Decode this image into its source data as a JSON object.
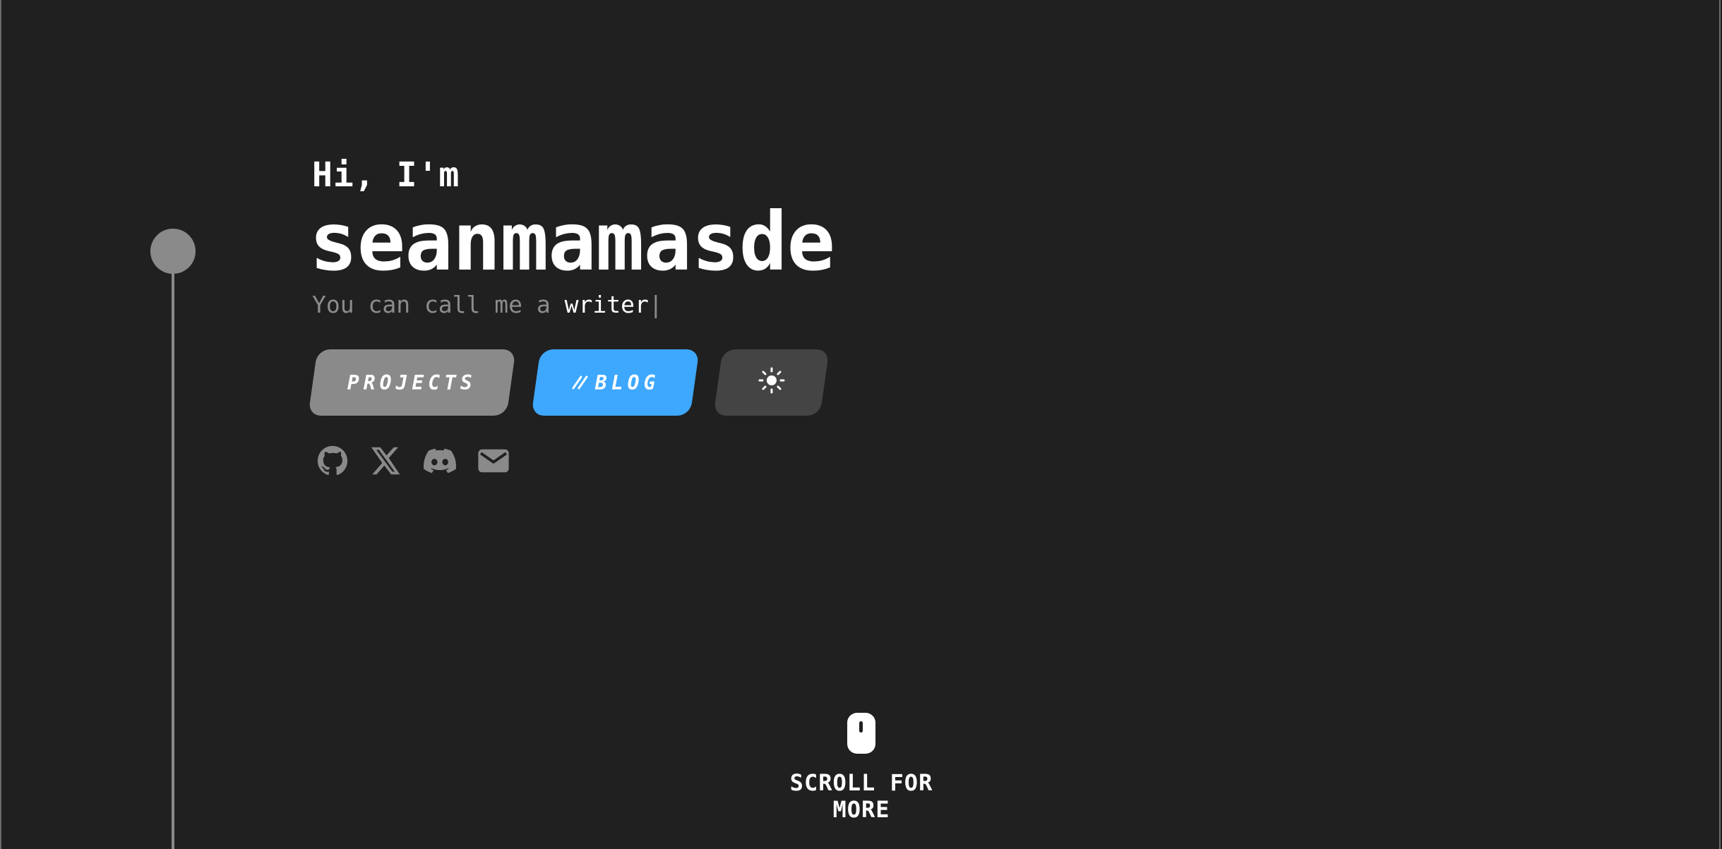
{
  "hero": {
    "greeting": "Hi, I'm",
    "name": "seanmamasde",
    "tagline_prefix": "You can call me a ",
    "tagline_role": "writer",
    "cursor": "|"
  },
  "buttons": {
    "projects_label": "PROJECTS",
    "blog_label": "BLOG",
    "blog_icon": "slash-icon",
    "theme_icon": "sun-icon"
  },
  "socials": [
    {
      "icon": "github-icon"
    },
    {
      "icon": "x-icon"
    },
    {
      "icon": "discord-icon"
    },
    {
      "icon": "mail-icon"
    }
  ],
  "scroll": {
    "label": "SCROLL FOR MORE",
    "icon": "mouse-icon"
  },
  "colors": {
    "background": "#202020",
    "accent": "#3ea8ff",
    "muted": "#8a8a8a",
    "theme_button": "#444444"
  }
}
